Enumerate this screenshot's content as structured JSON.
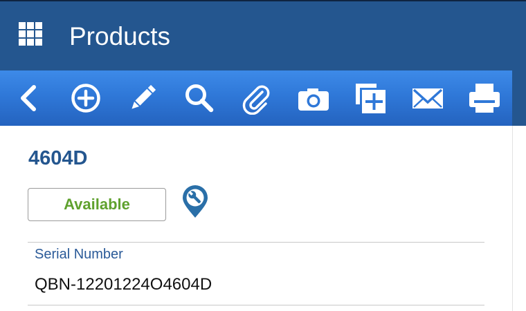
{
  "header": {
    "title": "Products",
    "menu_icon": "app-grid-icon"
  },
  "toolbar": {
    "buttons": [
      {
        "name": "back",
        "icon": "chevron-left-icon"
      },
      {
        "name": "add",
        "icon": "plus-circle-icon"
      },
      {
        "name": "edit",
        "icon": "pencil-icon"
      },
      {
        "name": "search",
        "icon": "magnifier-icon"
      },
      {
        "name": "attach",
        "icon": "paperclip-icon"
      },
      {
        "name": "photo",
        "icon": "camera-icon"
      },
      {
        "name": "duplicate",
        "icon": "copy-plus-icon"
      },
      {
        "name": "email",
        "icon": "envelope-icon"
      },
      {
        "name": "print",
        "icon": "printer-icon"
      }
    ]
  },
  "record": {
    "id": "4604D",
    "status": "Available",
    "status_color": "#5fa12e",
    "location_icon": "wrench-location-pin-icon"
  },
  "fields": [
    {
      "label": "Serial Number",
      "value": "QBN-12201224O4604D"
    }
  ],
  "colors": {
    "header_bg": "#24568f",
    "toolbar_bg": "#2f78d8",
    "accent": "#24568f"
  }
}
